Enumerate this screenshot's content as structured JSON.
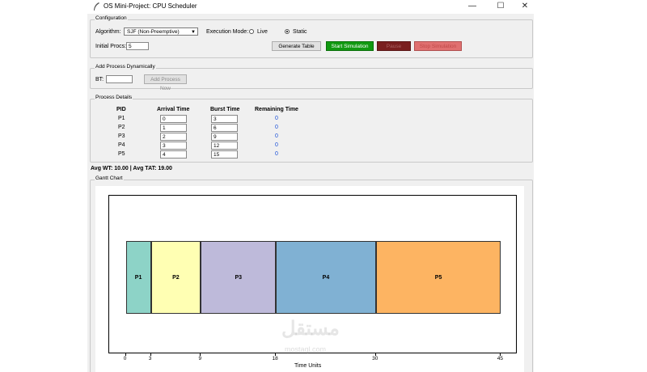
{
  "window": {
    "title": "OS Mini-Project: CPU Scheduler",
    "controls": {
      "minimize": "—",
      "maximize": "☐",
      "close": "✕"
    }
  },
  "config": {
    "legend": "Configuration",
    "algorithm_label": "Algorithm:",
    "algorithm_value": "SJF (Non-Preemptive)",
    "exec_mode_label": "Execution Mode:",
    "mode_live": "Live",
    "mode_static": "Static",
    "selected_mode": "Static",
    "initial_procs_label": "Initial Procs:",
    "initial_procs_value": "5",
    "buttons": {
      "generate": "Generate Table",
      "start": "Start Simulation",
      "pause": "Pause",
      "stop": "Stop Simulation"
    },
    "colors": {
      "start": "#119911",
      "pause": "#7a1f1f",
      "stop": "#e07070"
    }
  },
  "add_process": {
    "legend": "Add Process Dynamically",
    "bt_label": "BT:",
    "bt_value": "",
    "button": "Add Process Now"
  },
  "details": {
    "legend": "Process Details",
    "headers": [
      "PID",
      "Arrival Time",
      "Burst Time",
      "Remaining Time"
    ],
    "rows": [
      {
        "pid": "P1",
        "arrival": "0",
        "burst": "3",
        "remaining": "0"
      },
      {
        "pid": "P2",
        "arrival": "1",
        "burst": "6",
        "remaining": "0"
      },
      {
        "pid": "P3",
        "arrival": "2",
        "burst": "9",
        "remaining": "0"
      },
      {
        "pid": "P4",
        "arrival": "3",
        "burst": "12",
        "remaining": "0"
      },
      {
        "pid": "P5",
        "arrival": "4",
        "burst": "15",
        "remaining": "0"
      }
    ]
  },
  "stats": {
    "text": "Avg WT: 10.00 | Avg TAT: 19.00"
  },
  "gantt": {
    "legend": "Gantt Chart",
    "xlabel": "Time Units",
    "xlim": [
      -2,
      47
    ],
    "ticks": [
      "0",
      "3",
      "9",
      "18",
      "30",
      "45"
    ],
    "bars": [
      {
        "label": "P1",
        "start": 0,
        "end": 3,
        "color": "#8dd3c7"
      },
      {
        "label": "P2",
        "start": 3,
        "end": 9,
        "color": "#ffffb3"
      },
      {
        "label": "P3",
        "start": 9,
        "end": 18,
        "color": "#bebada"
      },
      {
        "label": "P4",
        "start": 18,
        "end": 30,
        "color": "#80b1d3"
      },
      {
        "label": "P5",
        "start": 30,
        "end": 45,
        "color": "#fdb462"
      }
    ]
  },
  "watermark": {
    "main": "مستقل",
    "sub": "mostaql.com"
  }
}
